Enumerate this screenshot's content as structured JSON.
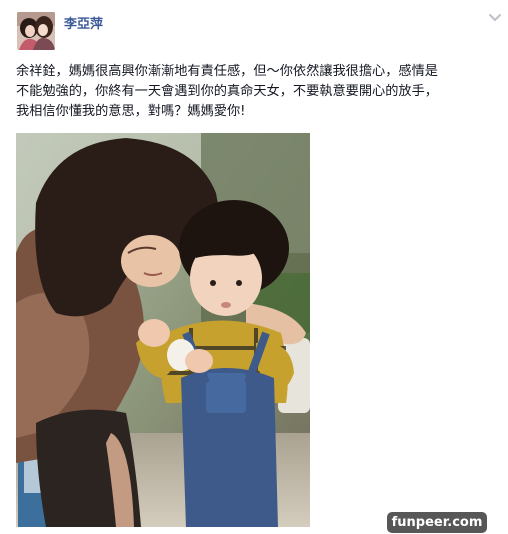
{
  "post": {
    "author_name": "李亞萍",
    "text_lines": [
      "余祥銓，媽媽很高興你漸漸地有責任感，但～你依然讓我很擔心，感情是",
      "不能勉強的，你終有一天會遇到你的真命天女，不要執意要開心的放手，",
      "我相信你懂我的意思，對嗎？媽媽愛你!"
    ]
  },
  "icons": {
    "options": "chevron-down-icon"
  },
  "watermark": {
    "text": "funpeer.com"
  },
  "colors": {
    "author_link": "#3b5998",
    "body_text": "#141823",
    "watermark_bg": "#575757"
  }
}
